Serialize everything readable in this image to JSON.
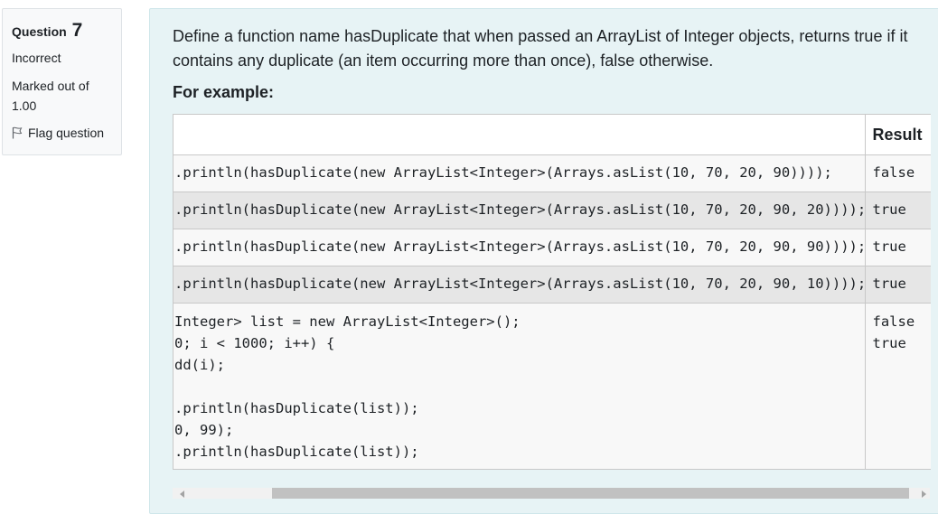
{
  "info": {
    "question_label": "Question",
    "question_number": "7",
    "state": "Incorrect",
    "grade_line1": "Marked out of",
    "grade_line2": "1.00",
    "flag_label": "Flag question"
  },
  "question": {
    "text": "Define a function name hasDuplicate that when passed an ArrayList of Integer objects, returns true if it contains any duplicate (an item occurring more than once), false otherwise.",
    "example_heading": "For example:"
  },
  "table": {
    "header_test": "",
    "header_result": "Result",
    "rows": [
      {
        "code": ".println(hasDuplicate(new ArrayList<Integer>(Arrays.asList(10, 70, 20, 90))));",
        "result": "false"
      },
      {
        "code": ".println(hasDuplicate(new ArrayList<Integer>(Arrays.asList(10, 70, 20, 90, 20))));",
        "result": "true"
      },
      {
        "code": ".println(hasDuplicate(new ArrayList<Integer>(Arrays.asList(10, 70, 20, 90, 90))));",
        "result": "true"
      },
      {
        "code": ".println(hasDuplicate(new ArrayList<Integer>(Arrays.asList(10, 70, 20, 90, 10))));",
        "result": "true"
      },
      {
        "code": "Integer> list = new ArrayList<Integer>();\n0; i < 1000; i++) {\ndd(i);\n\n.println(hasDuplicate(list));\n0, 99);\n.println(hasDuplicate(list));",
        "result": "false\ntrue"
      }
    ]
  },
  "colors": {
    "content_bg": "#e7f3f5",
    "info_bg": "#f8f9fa",
    "row_alt": "#e6e6e6"
  },
  "icons": {
    "flag": "flag-outline-icon"
  }
}
